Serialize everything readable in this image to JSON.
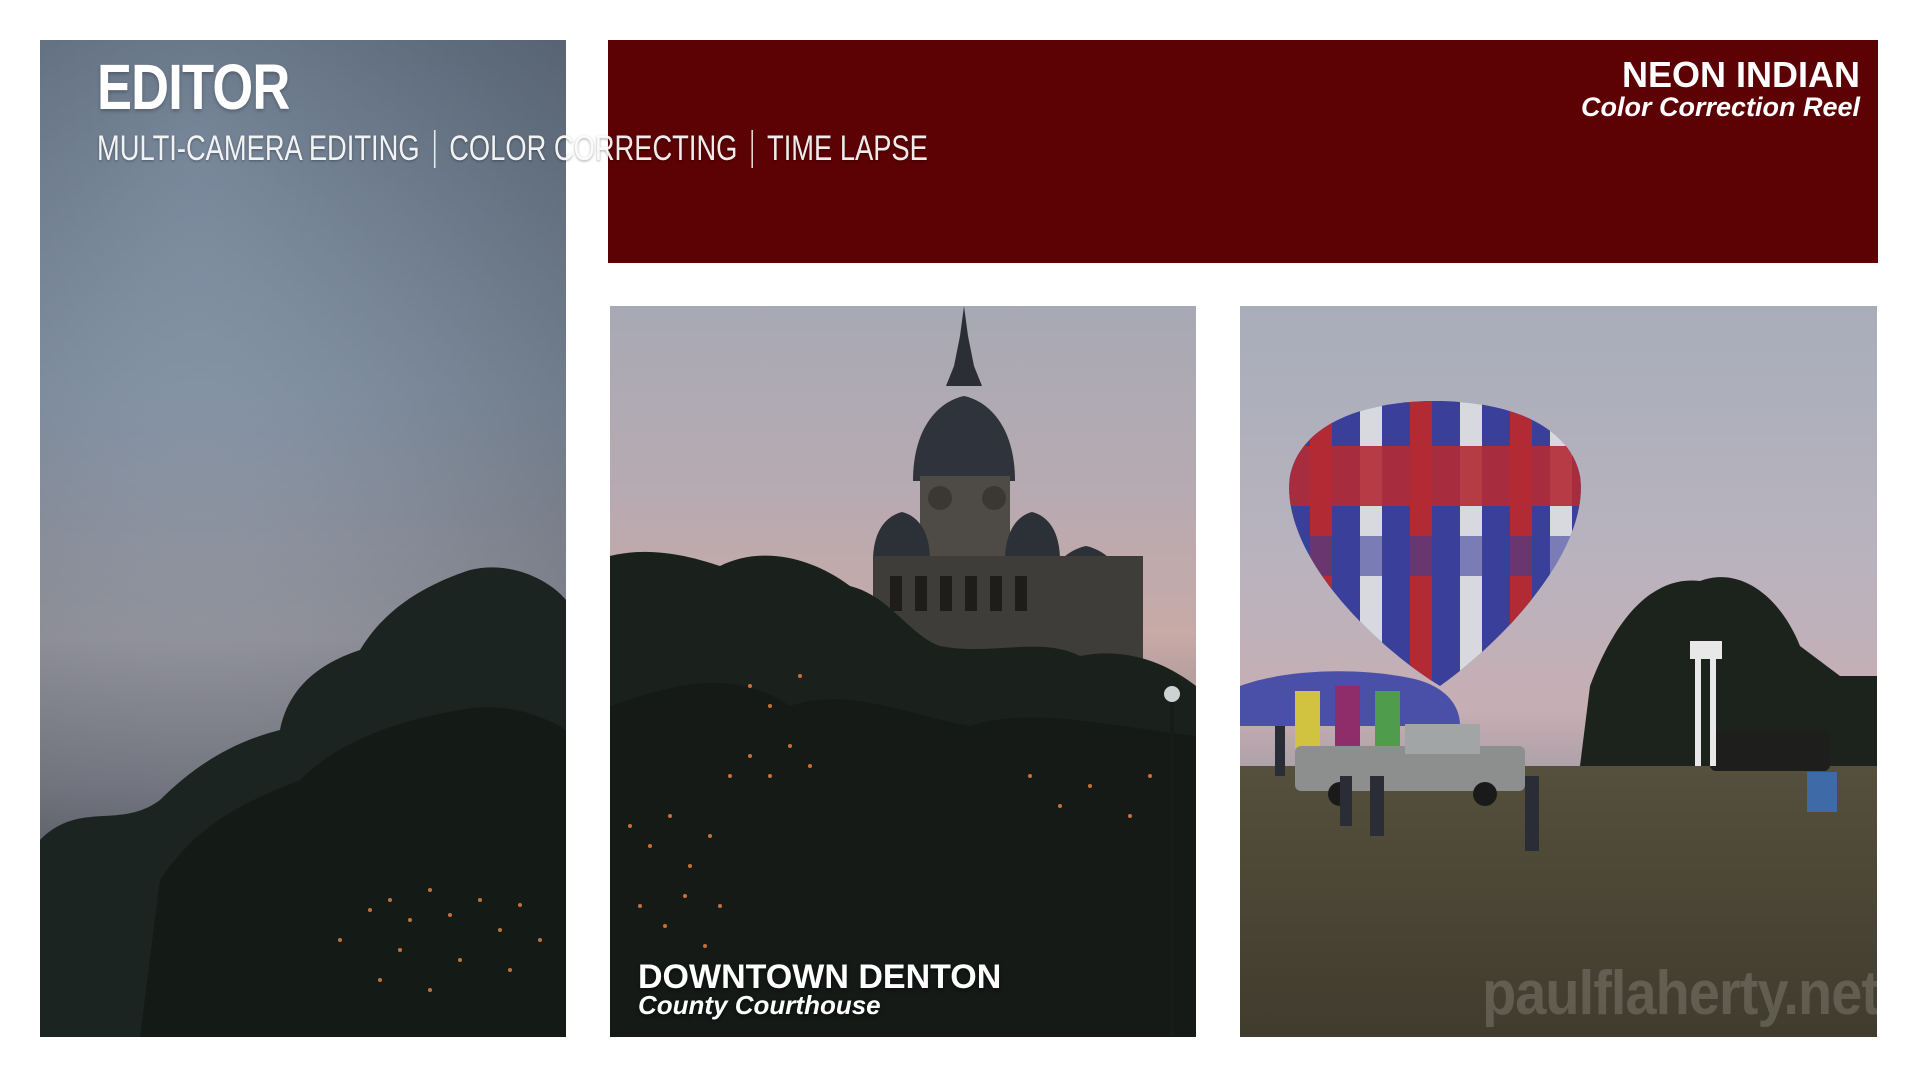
{
  "editor": {
    "title": "EDITOR",
    "skills": [
      "MULTI-CAMERA EDITING",
      "COLOR CORRECTING",
      "TIME LAPSE"
    ]
  },
  "banner": {
    "title": "NEON INDIAN",
    "subtitle": "Color Correction Reel",
    "color": "#5c0205"
  },
  "courthouse_caption": {
    "title": "DOWNTOWN DENTON",
    "subtitle": "County Courthouse"
  },
  "watermark": "paulflaherty.net",
  "icons": [
    "sky-tree-photo",
    "courthouse-photo",
    "hot-air-balloon-photo"
  ]
}
